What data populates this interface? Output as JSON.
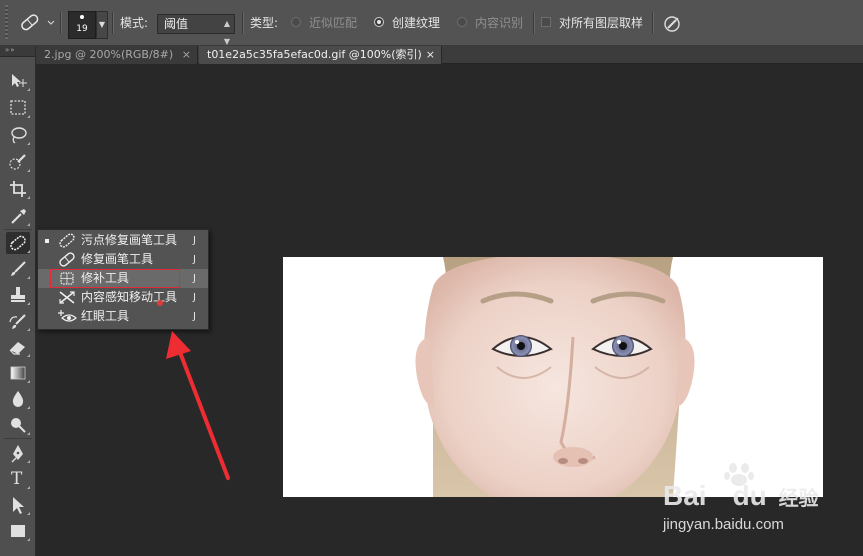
{
  "options_bar": {
    "brush_size": "19",
    "mode_label": "模式:",
    "mode_value": "阈值",
    "type_label": "类型:",
    "type_options": [
      {
        "label": "近似匹配",
        "selected": false,
        "enabled": false
      },
      {
        "label": "创建纹理",
        "selected": true,
        "enabled": true
      },
      {
        "label": "内容识别",
        "selected": false,
        "enabled": false
      }
    ],
    "sample_all_layers": {
      "label": "对所有图层取样",
      "checked": false
    }
  },
  "tabs": [
    {
      "label": "2.jpg @ 200%(RGB/8#)",
      "active": false
    },
    {
      "label": "t01e2a5c35fa5efac0d.gif @100%(索引)",
      "active": true
    }
  ],
  "tab_close_glyph": "×",
  "tools": [
    "move-tool-icon",
    "marquee-tool-icon",
    "lasso-tool-icon",
    "quick-selection-tool-icon",
    "crop-tool-icon",
    "eyedropper-tool-icon",
    "healing-brush-tool-icon",
    "brush-tool-icon",
    "clone-stamp-tool-icon",
    "history-brush-tool-icon",
    "eraser-tool-icon",
    "gradient-tool-icon",
    "blur-tool-icon",
    "dodge-tool-icon",
    "pen-tool-icon",
    "type-tool-icon",
    "path-selection-tool-icon",
    "rectangle-tool-icon"
  ],
  "type_tool_glyph": "T",
  "flyout_menu": {
    "items": [
      {
        "label": "污点修复画笔工具",
        "shortcut": "J",
        "active_tool": true,
        "highlighted": false
      },
      {
        "label": "修复画笔工具",
        "shortcut": "J",
        "active_tool": false,
        "highlighted": false
      },
      {
        "label": "修补工具",
        "shortcut": "J",
        "active_tool": false,
        "highlighted": true
      },
      {
        "label": "内容感知移动工具",
        "shortcut": "J",
        "active_tool": false,
        "highlighted": false
      },
      {
        "label": "红眼工具",
        "shortcut": "J",
        "active_tool": false,
        "highlighted": false
      }
    ]
  },
  "watermark": {
    "brand": "Bai",
    "brand2": "du",
    "cn": "经验",
    "url": "jingyan.baidu.com"
  },
  "colors": {
    "accent_red": "#e02b3a",
    "panel": "#535353",
    "canvas": "#282828"
  }
}
